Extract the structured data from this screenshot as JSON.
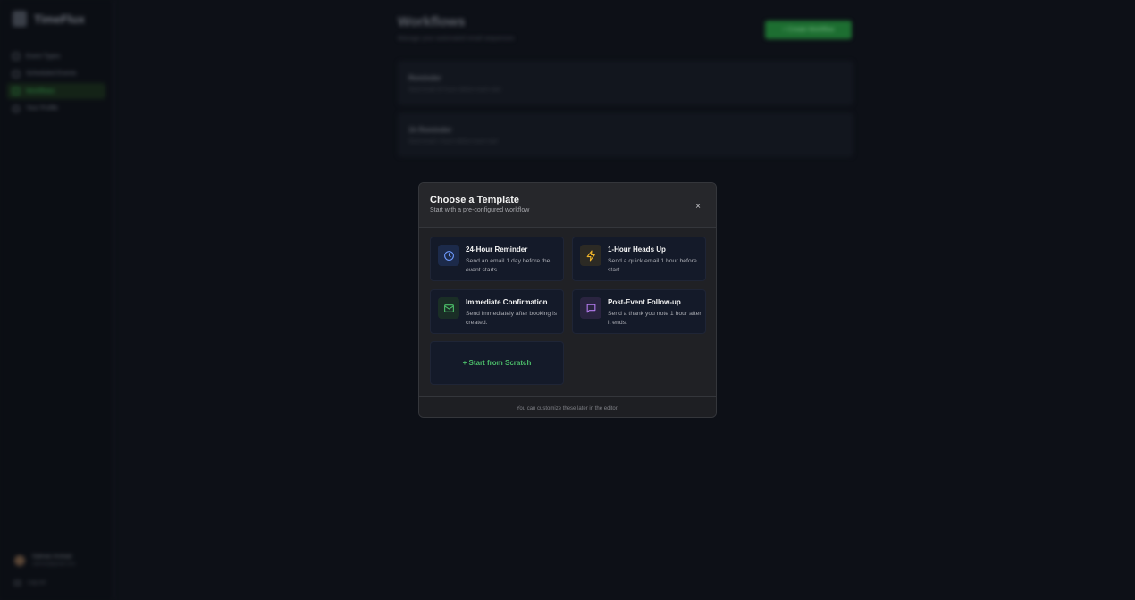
{
  "app": {
    "name": "TimeFlux",
    "nav": [
      {
        "label": "Event Types"
      },
      {
        "label": "Scheduled Events"
      },
      {
        "label": "Workflows"
      },
      {
        "label": "Your Profile"
      }
    ],
    "user": {
      "name": "Salman Arshad",
      "email": "salman@gmail.com"
    },
    "logout_label": "Log out"
  },
  "page": {
    "title": "Workflows",
    "subtitle": "Manage your automated email sequences",
    "create_label": "+ Create Workflow",
    "workflows": [
      {
        "title": "Reminder",
        "desc": "Send email 24 hours before event start"
      },
      {
        "title": "1h Reminder",
        "desc": "Send email 1 hours before event start"
      }
    ]
  },
  "modal": {
    "title": "Choose a Template",
    "subtitle": "Start with a pre-configured workflow",
    "close_icon": "×",
    "templates": [
      {
        "title": "24-Hour Reminder",
        "desc": "Send an email 1 day before the event starts.",
        "icon": "clock-icon",
        "color": "#6f9bff"
      },
      {
        "title": "1-Hour Heads Up",
        "desc": "Send a quick email 1 hour before start.",
        "icon": "lightning-icon",
        "color": "#f0b429"
      },
      {
        "title": "Immediate Confirmation",
        "desc": "Send immediately after booking is created.",
        "icon": "mail-icon",
        "color": "#4cbe6a"
      },
      {
        "title": "Post-Event Follow-up",
        "desc": "Send a thank you note 1 hour after it ends.",
        "icon": "message-icon",
        "color": "#b57cf0"
      }
    ],
    "scratch_label": "+ Start from Scratch",
    "footer": "You can customize these later in the editor."
  }
}
